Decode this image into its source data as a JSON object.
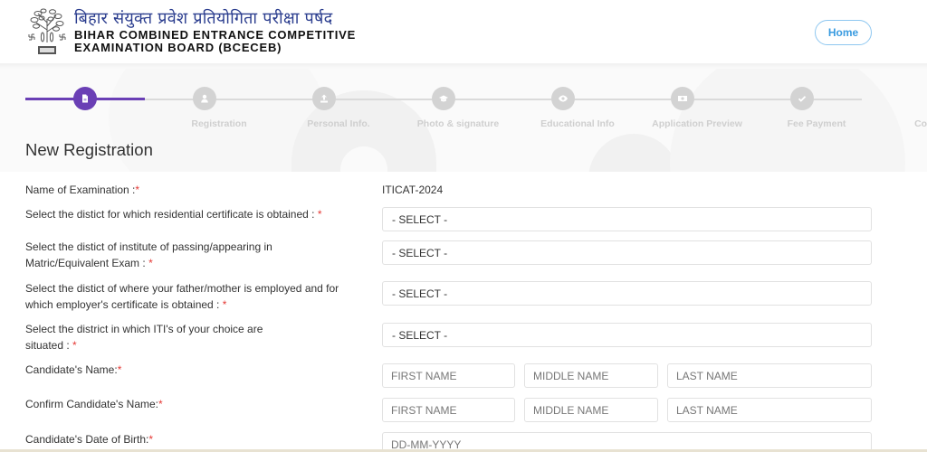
{
  "header": {
    "hindi_title": "बिहार संयुक्त प्रवेश प्रतियोगिता परीक्षा पर्षद",
    "english_title_line1": "BIHAR COMBINED ENTRANCE COMPETITIVE",
    "english_title_line2": "EXAMINATION BOARD (BCECEB)",
    "home_label": "Home"
  },
  "stepper": {
    "active_color": "#6a3fb5",
    "inactive_color": "#d3d3d3",
    "steps": [
      {
        "label": "Registration",
        "icon": "document-icon",
        "active": true
      },
      {
        "label": "Personal Info.",
        "icon": "user-icon",
        "active": false
      },
      {
        "label": "Photo & signature",
        "icon": "upload-icon",
        "active": false
      },
      {
        "label": "Educational Info",
        "icon": "graduation-cap-icon",
        "active": false
      },
      {
        "label": "Application Preview",
        "icon": "eye-icon",
        "active": false
      },
      {
        "label": "Fee Payment",
        "icon": "money-icon",
        "active": false
      },
      {
        "label": "Complete",
        "icon": "check-icon",
        "active": false
      }
    ]
  },
  "page_title": "New Registration",
  "form": {
    "exam_label": "Name of Examination :",
    "exam_value": "ITICAT-2024",
    "residential_label": "Select the distict for which residential certificate is obtained : ",
    "residential_value": "- SELECT -",
    "matric_label_1": "Select the distict of institute of passing/appearing in",
    "matric_label_2": "Matric/Equivalent Exam : ",
    "matric_value": "- SELECT -",
    "employer_label_1": "Select the distict of where your father/mother is employed and for",
    "employer_label_2": "which employer's certificate is obtained : ",
    "employer_value": "- SELECT -",
    "iti_label_1": "Select the district in which ITI's of your choice are",
    "iti_label_2": "situated : ",
    "iti_value": "- SELECT -",
    "name_label": "Candidate's Name:",
    "confirm_name_label": "Confirm Candidate's Name:",
    "dob_label": "Candidate's Date of Birth:",
    "first_name_placeholder": "FIRST NAME",
    "middle_name_placeholder": "MIDDLE NAME",
    "last_name_placeholder": "LAST NAME",
    "dob_placeholder": "DD-MM-YYYY",
    "required_mark": "*"
  }
}
